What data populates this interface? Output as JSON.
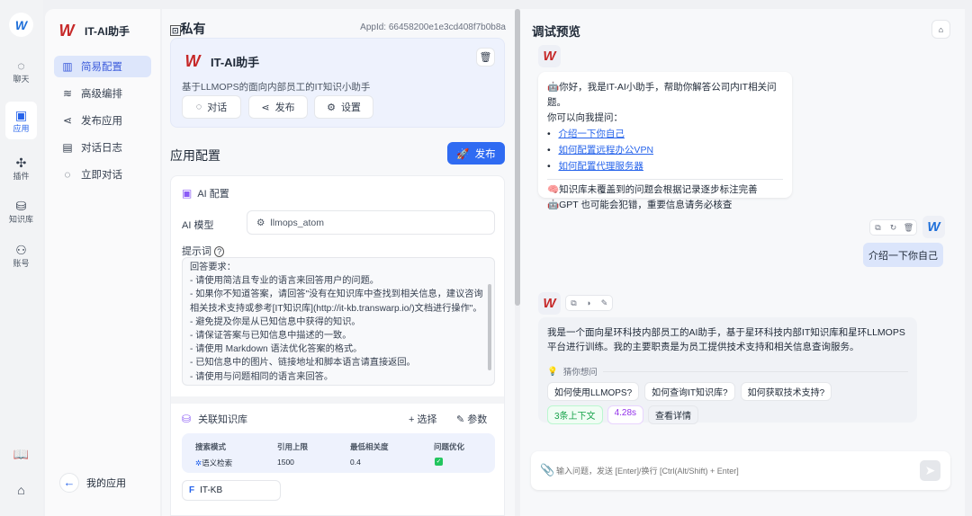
{
  "rail": {
    "logo": "W",
    "items": [
      {
        "label": "聊天",
        "icon": "chat-icon"
      },
      {
        "label": "应用",
        "icon": "robot-icon"
      },
      {
        "label": "插件",
        "icon": "puzzle-icon"
      },
      {
        "label": "知识库",
        "icon": "database-icon"
      },
      {
        "label": "账号",
        "icon": "user-icon"
      }
    ],
    "bottom": [
      "book-icon",
      "github-icon"
    ]
  },
  "sidebar": {
    "app_name": "IT-AI助手",
    "items": [
      {
        "label": "简易配置",
        "icon": "chart-icon"
      },
      {
        "label": "高级编排",
        "icon": "layers-icon"
      },
      {
        "label": "发布应用",
        "icon": "share-icon"
      },
      {
        "label": "对话日志",
        "icon": "calendar-icon"
      },
      {
        "label": "立即对话",
        "icon": "chat-icon"
      }
    ],
    "back_label": "我的应用"
  },
  "app": {
    "visibility": "私有",
    "app_id": "AppId: 66458200e1e3cd408f7b0b8a",
    "name": "IT-AI助手",
    "description": "基于LLMOPS的面向内部员工的IT知识小助手",
    "buttons": [
      "对话",
      "发布",
      "设置"
    ]
  },
  "config": {
    "title": "应用配置",
    "publish": "发布",
    "ai_section": "AI 配置",
    "model_label": "AI 模型",
    "model": "llmops_atom",
    "prompt_label": "提示词",
    "prompt_lines": [
      "回答要求：",
      "- 请使用简洁且专业的语言来回答用户的问题。",
      "- 如果你不知道答案，请回答\"没有在知识库中查找到相关信息，建议咨询",
      "相关技术支持或参考[IT知识库](http://it-kb.transwarp.io/)文档进行操作\"。",
      "- 避免提及你是从已知信息中获得的知识。",
      "- 请保证答案与已知信息中描述的一致。",
      "- 请使用 Markdown 语法优化答案的格式。",
      "- 已知信息中的图片、链接地址和脚本语言请直接返回。",
      "- 请使用与问题相同的语言来回答。"
    ],
    "kb_title": "关联知识库",
    "kb_select": "+ 选择",
    "kb_params": "参数",
    "kb_headers": [
      "搜索模式",
      "引用上限",
      "最低相关度",
      "问题优化"
    ],
    "kb_values": [
      "语义检索",
      "1500",
      "0.4"
    ],
    "kb_optimize": true,
    "kb_name": "IT-KB"
  },
  "preview": {
    "title": "调试预览",
    "welcome": "你好，我是IT-AI小助手，帮助你解答公司内IT相关问题。",
    "ask_intro": "你可以向我提问：",
    "questions": [
      "介绍一下你自己",
      "如何配置远程办公VPN",
      "如何配置代理服务器"
    ],
    "note1": "知识库未覆盖到的问题会根据记录逐步标注完善",
    "note2": "GPT 也可能会犯错，重要信息请务必核查",
    "user_msg": "介绍一下你自己",
    "answer": "我是一个面向星环科技内部员工的AI助手，基于星环科技内部IT知识库和星环LLMOPS平台进行训练。我的主要职责是为员工提供技术支持和相关信息查询服务。",
    "guess_label": "猜你想问",
    "guesses": [
      "如何使用LLMOPS?",
      "如何查询IT知识库?",
      "如何获取技术支持?"
    ],
    "context": "3条上下文",
    "time": "4.28s",
    "details": "查看详情",
    "input_placeholder": "输入问题，发送 [Enter]/换行 [Ctrl(Alt/Shift) + Enter]"
  }
}
